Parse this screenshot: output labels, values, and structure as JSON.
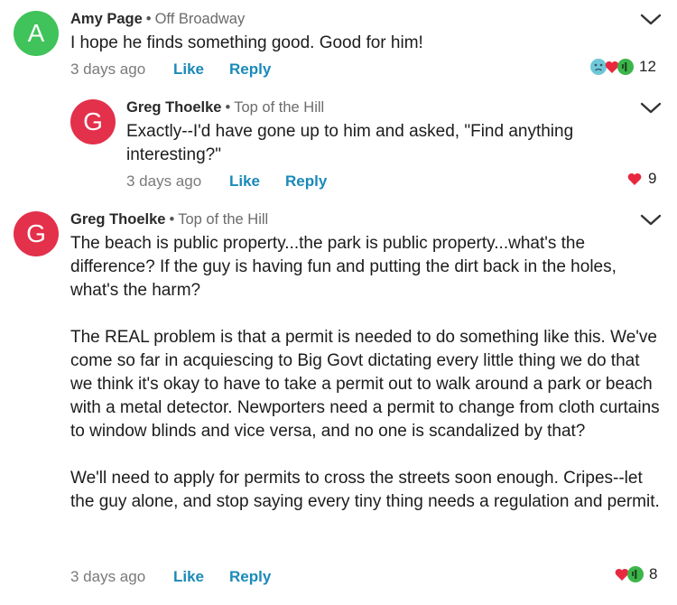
{
  "comments": [
    {
      "avatar_letter": "A",
      "avatar_color": "#3fc35a",
      "author": "Amy Page",
      "neighborhood": "Off Broadway",
      "paragraphs": [
        "I hope he finds something good. Good for him!"
      ],
      "time": "3 days ago",
      "like_label": "Like",
      "reply_label": "Reply",
      "reaction_icons": [
        "sad-reaction-icon",
        "heart-reaction-icon",
        "agree-reaction-icon"
      ],
      "reaction_count": "12"
    },
    {
      "avatar_letter": "G",
      "avatar_color": "#e3304b",
      "author": "Greg Thoelke",
      "neighborhood": "Top of the Hill",
      "paragraphs": [
        "Exactly--I'd have gone up to him and asked, \"Find anything interesting?\""
      ],
      "time": "3 days ago",
      "like_label": "Like",
      "reply_label": "Reply",
      "reaction_icons": [
        "heart-reaction-icon"
      ],
      "reaction_count": "9"
    },
    {
      "avatar_letter": "G",
      "avatar_color": "#e3304b",
      "author": "Greg Thoelke",
      "neighborhood": "Top of the Hill",
      "paragraphs": [
        "The beach is public property...the park is public property...what's the difference?  If the guy is having fun and putting the dirt back in the holes, what's the harm?",
        "The REAL problem is that a permit is needed to do something like this. We've come so far in acquiescing to Big Govt dictating every little thing we do that we think it's okay to have to take a permit out to walk around a park or beach with a metal detector.  Newporters need a permit to change from cloth curtains to window blinds and vice versa, and no one is scandalized by that?",
        "We'll need to apply for permits to cross the streets soon enough.  Cripes--let the guy alone, and stop saying every tiny thing needs a regulation and permit."
      ],
      "time": "3 days ago",
      "like_label": "Like",
      "reply_label": "Reply",
      "reaction_icons": [
        "heart-reaction-icon",
        "agree-reaction-icon"
      ],
      "reaction_count": "8"
    }
  ],
  "colors": {
    "link": "#1a8ab8",
    "heart": "#e8283f",
    "agree": "#3cb54a",
    "sad": "#6fc7d8"
  }
}
